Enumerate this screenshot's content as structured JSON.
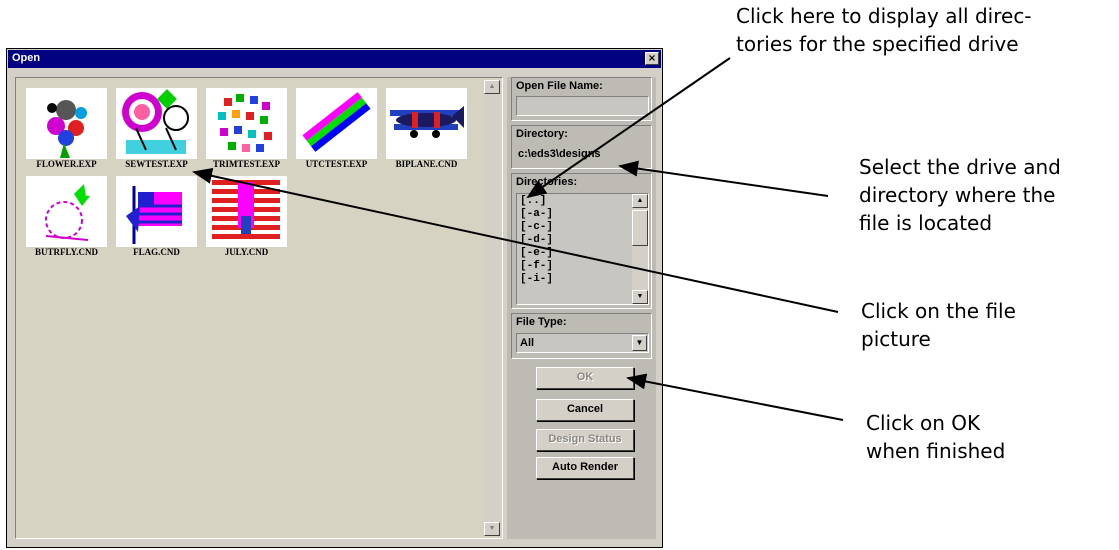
{
  "window": {
    "title": "Open",
    "close_glyph": "×"
  },
  "files": [
    {
      "name": "FLOWER.EXP"
    },
    {
      "name": "SEWTEST.EXP"
    },
    {
      "name": "TRIMTEST.EXP"
    },
    {
      "name": "UTCTEST.EXP"
    },
    {
      "name": "BIPLANE.CND"
    },
    {
      "name": "BUTRFLY.CND"
    },
    {
      "name": "FLAG.CND"
    },
    {
      "name": "JULY.CND"
    }
  ],
  "open_file_name": {
    "label": "Open File Name:",
    "value": ""
  },
  "directory": {
    "label": "Directory:",
    "value": "c:\\eds3\\designs"
  },
  "directories": {
    "label": "Directories:",
    "items": [
      "[..]",
      "[-a-]",
      "[-c-]",
      "[-d-]",
      "[-e-]",
      "[-f-]",
      "[-i-]"
    ]
  },
  "file_type": {
    "label": "File Type:",
    "value": "All"
  },
  "buttons": {
    "ok": "OK",
    "cancel": "Cancel",
    "design_status": "Design Status",
    "auto_render": "Auto Render"
  },
  "annotations": {
    "directories": "Click here to display all direc-\ntories for the specified drive",
    "drive": "Select the drive and\ndirectory where the\nfile is located",
    "picture": "Click on the file\npicture",
    "ok": "Click on OK\nwhen finished"
  }
}
